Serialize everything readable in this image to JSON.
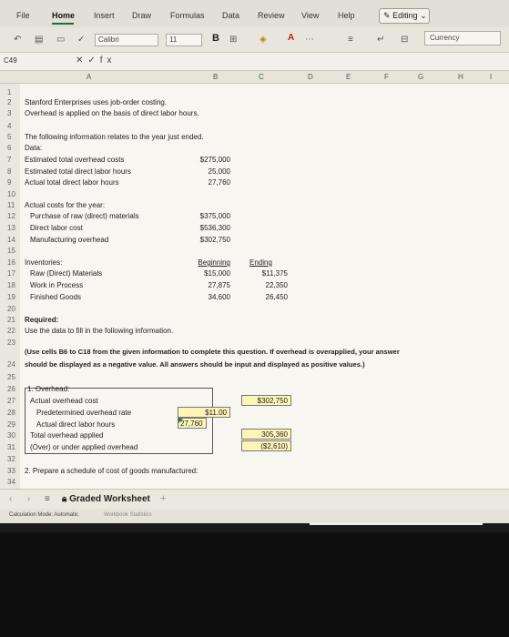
{
  "ribbon": {
    "tabs": [
      "File",
      "Home",
      "Insert",
      "Draw",
      "Formulas",
      "Data",
      "Review",
      "View",
      "Help"
    ],
    "active_tab": "Home",
    "editing_label": "Editing"
  },
  "toolbar": {
    "font_name": "Calibri",
    "font_size": "11",
    "bold_label": "B",
    "number_format": "Currency"
  },
  "formula_bar": {
    "name_box": "C49",
    "fx_label": "fx"
  },
  "columns": [
    "A",
    "B",
    "C",
    "D",
    "E",
    "F",
    "G",
    "H",
    "I"
  ],
  "selected_column": "C",
  "rows": [
    "1",
    "2",
    "3",
    "4",
    "5",
    "6",
    "7",
    "8",
    "9",
    "10",
    "11",
    "12",
    "13",
    "14",
    "15",
    "16",
    "17",
    "18",
    "19",
    "20",
    "21",
    "22",
    "23",
    "24",
    "25",
    "26",
    "27",
    "28",
    "29",
    "30",
    "31",
    "32",
    "33",
    "34"
  ],
  "sheet": {
    "r2": "Stanford Enterprises uses job-order costing.",
    "r3": "Overhead is applied on the basis of direct labor hours.",
    "r5": "The following information relates to the year just ended.",
    "r6": "Data:",
    "r7_label": "Estimated total overhead costs",
    "r7_value": "$275,000",
    "r8_label": "Estimated total direct labor hours",
    "r8_value": "25,000",
    "r9_label": "Actual total direct labor hours",
    "r9_value": "27,760",
    "r11": "Actual costs for the year:",
    "r12_label": "Purchase of raw (direct) materials",
    "r12_value": "$375,000",
    "r13_label": "Direct labor cost",
    "r13_value": "$536,300",
    "r14_label": "Manufacturing overhead",
    "r14_value": "$302,750",
    "r16_label": "Inventories:",
    "r16_beginning": "Beginning",
    "r16_ending": "Ending",
    "r17_label": "Raw (Direct) Materials",
    "r17_beginning": "$15,000",
    "r17_ending": "$11,375",
    "r18_label": "Work in Process",
    "r18_beginning": "27,875",
    "r18_ending": "22,350",
    "r19_label": "Finished Goods",
    "r19_beginning": "34,600",
    "r19_ending": "26,450",
    "r21": "Required:",
    "r22": "Use the data to fill in the following information.",
    "r24_line1": "(Use cells B6 to C18 from the given information to complete this question. If overhead is overapplied, your answer",
    "r24_line2": "should be displayed as a negative value. All answers should be input and displayed as positive values.)",
    "r26": "1. Overhead:",
    "r27_label": "Actual overhead cost",
    "r27_value": "$302,750",
    "r28_label": "Predetermined overhead rate",
    "r28_value": "$11.00",
    "r29_label": "Actual direct labor hours",
    "r29_value": "27,760",
    "r30_label": "Total overhead applied",
    "r30_value": "305,360",
    "r31_label": "(Over) or under applied overhead",
    "r31_value": "($2,610)",
    "r33": "2. Prepare a schedule of cost of goods manufactured:"
  },
  "sheet_tab": "Graded Worksheet",
  "status": {
    "calc_mode": "Calculation Mode: Automatic",
    "stats": "Workbook Statistics"
  },
  "colors": {
    "accent": "#1f6d3c",
    "input_fill": "#fdf4b8"
  }
}
